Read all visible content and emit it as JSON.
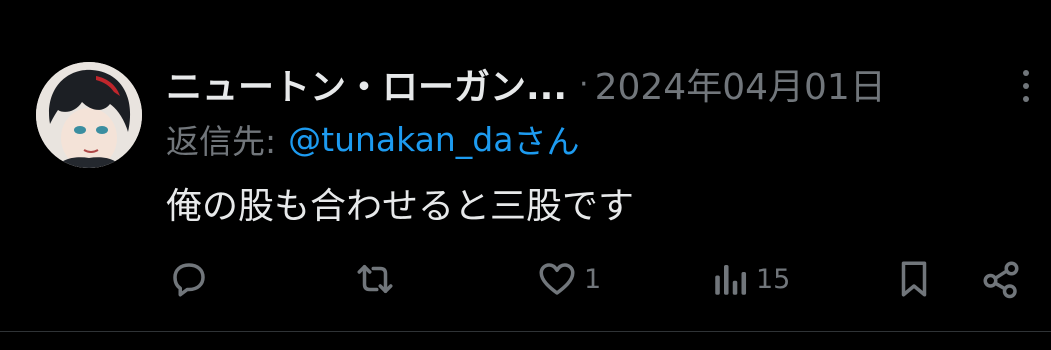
{
  "post": {
    "author_name": "ニュートン・ローガン...",
    "separator": "·",
    "date": "2024年04月01日",
    "reply_prefix": "返信先:",
    "reply_handle": "@tunakan_da",
    "reply_suffix": "さん",
    "text": "俺の股も合わせると三股です"
  },
  "actions": {
    "likes": "1",
    "views": "15"
  },
  "colors": {
    "background": "#000000",
    "text": "#e7e9ea",
    "muted": "#71767b",
    "link": "#1d9bf0"
  },
  "icons": [
    "avatar",
    "more-icon",
    "reply-icon",
    "retweet-icon",
    "like-icon",
    "views-icon",
    "bookmark-icon",
    "share-icon"
  ]
}
